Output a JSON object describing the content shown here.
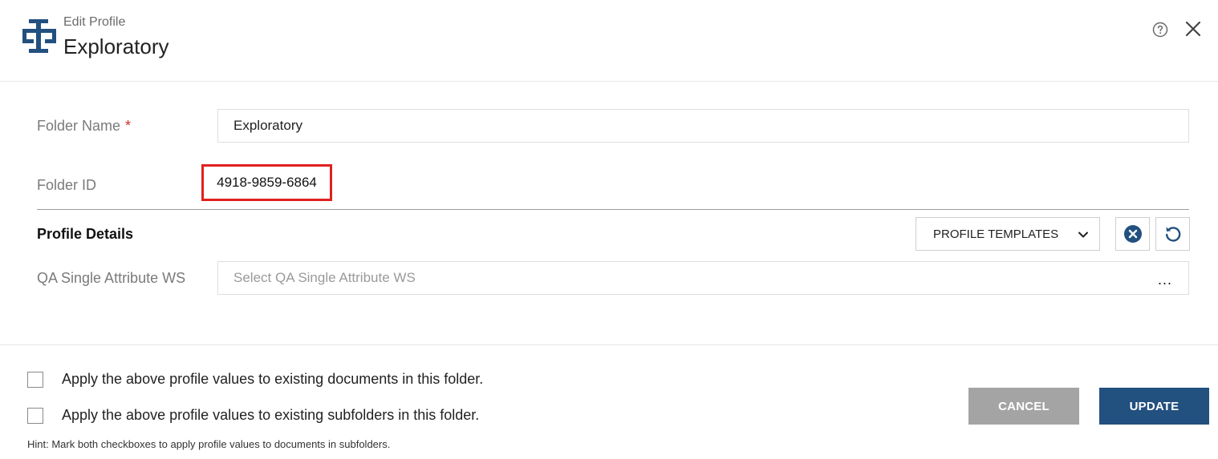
{
  "header": {
    "subtitle": "Edit Profile",
    "title": "Exploratory",
    "help_icon": "help-circle-icon",
    "close_icon": "close-icon"
  },
  "form": {
    "folder_name": {
      "label": "Folder Name",
      "required_mark": "*",
      "value": "Exploratory"
    },
    "folder_id": {
      "label": "Folder ID",
      "value": "4918-9859-6864",
      "highlight_color": "#e0201f"
    }
  },
  "profile_details": {
    "title": "Profile Details",
    "templates_button": "PROFILE TEMPLATES",
    "clear_icon": "clear-circle-icon",
    "reset_icon": "refresh-icon",
    "fields": [
      {
        "label": "QA Single Attribute WS",
        "placeholder": "Select QA Single Attribute WS",
        "more_icon": "..."
      }
    ]
  },
  "options": [
    {
      "label": "Apply the above profile values to existing documents in this folder.",
      "checked": false
    },
    {
      "label": "Apply the above profile values to existing subfolders in this folder.",
      "checked": false
    }
  ],
  "hint": "Hint: Mark both checkboxes to apply profile values to documents in subfolders.",
  "buttons": {
    "cancel": "CANCEL",
    "update": "UPDATE"
  },
  "colors": {
    "accent": "#22507f",
    "cancel": "#a4a4a4",
    "required": "#d0302e"
  }
}
